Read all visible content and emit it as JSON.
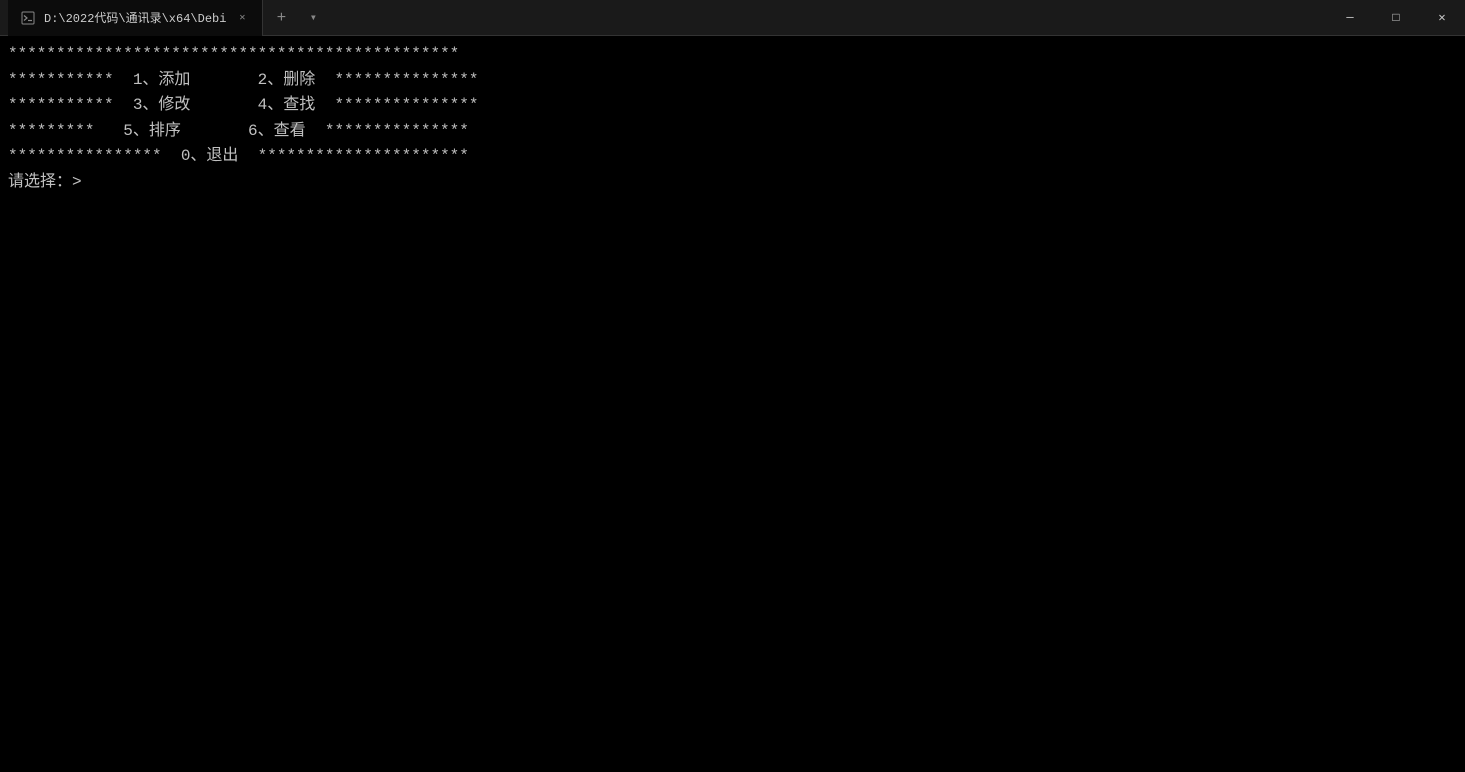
{
  "titlebar": {
    "tab_title": "D:\\2022代码\\通讯录\\x64\\Debi",
    "new_tab_icon": "+",
    "dropdown_icon": "▾",
    "minimize_icon": "─",
    "maximize_icon": "□",
    "close_icon": "✕"
  },
  "terminal": {
    "line1": "***********************************************",
    "line2": "***********  1、添加       2、删除  ***************",
    "line3": "***********  3、修改       4、查找  ***************",
    "line4": "*********   5、排序       6、查看  ***************",
    "line5": "****************  0、退出  **********************",
    "prompt": "请选择：>"
  }
}
